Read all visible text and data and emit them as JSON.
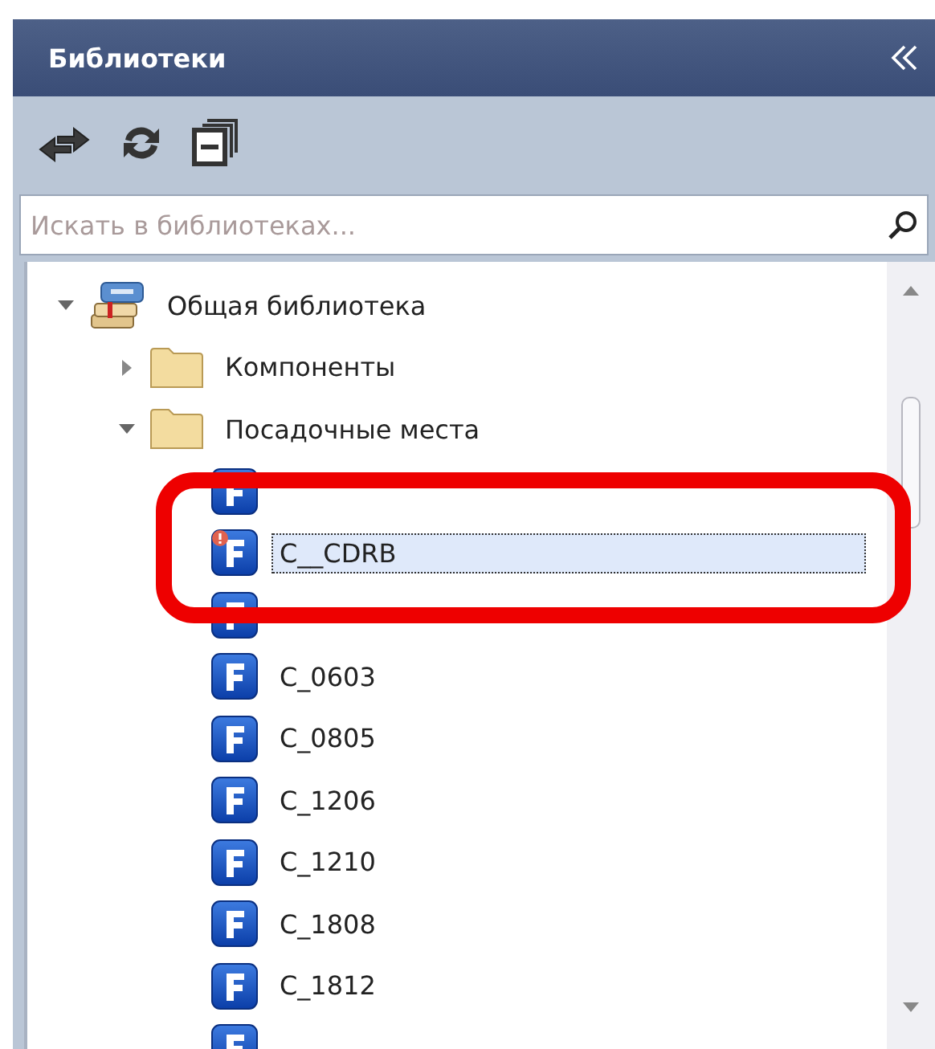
{
  "panel": {
    "title": "Библиотеки"
  },
  "search": {
    "placeholder": "Искать в библиотеках..."
  },
  "tree": [
    {
      "label": "Общая библиотека",
      "kind": "library",
      "expanded": true,
      "children": [
        {
          "label": "Компоненты",
          "kind": "folder",
          "expanded": false
        },
        {
          "label": "Посадочные места",
          "kind": "folder",
          "expanded": true,
          "children": [
            {
              "kind": "footprint",
              "selected": false,
              "warning": false
            },
            {
              "label": "C__CDRB",
              "kind": "footprint",
              "selected": true,
              "warning": true
            },
            {
              "kind": "footprint",
              "selected": false,
              "warning": false
            },
            {
              "label": "C_0603",
              "kind": "footprint",
              "selected": false,
              "warning": false
            },
            {
              "label": "C_0805",
              "kind": "footprint",
              "selected": false,
              "warning": false
            },
            {
              "label": "C_1206",
              "kind": "footprint",
              "selected": false,
              "warning": false
            },
            {
              "label": "C_1210",
              "kind": "footprint",
              "selected": false,
              "warning": false
            },
            {
              "label": "C_1808",
              "kind": "footprint",
              "selected": false,
              "warning": false
            },
            {
              "label": "C_1812",
              "kind": "footprint",
              "selected": false,
              "warning": false
            },
            {
              "kind": "footprint",
              "selected": false,
              "warning": false
            }
          ]
        }
      ]
    }
  ]
}
